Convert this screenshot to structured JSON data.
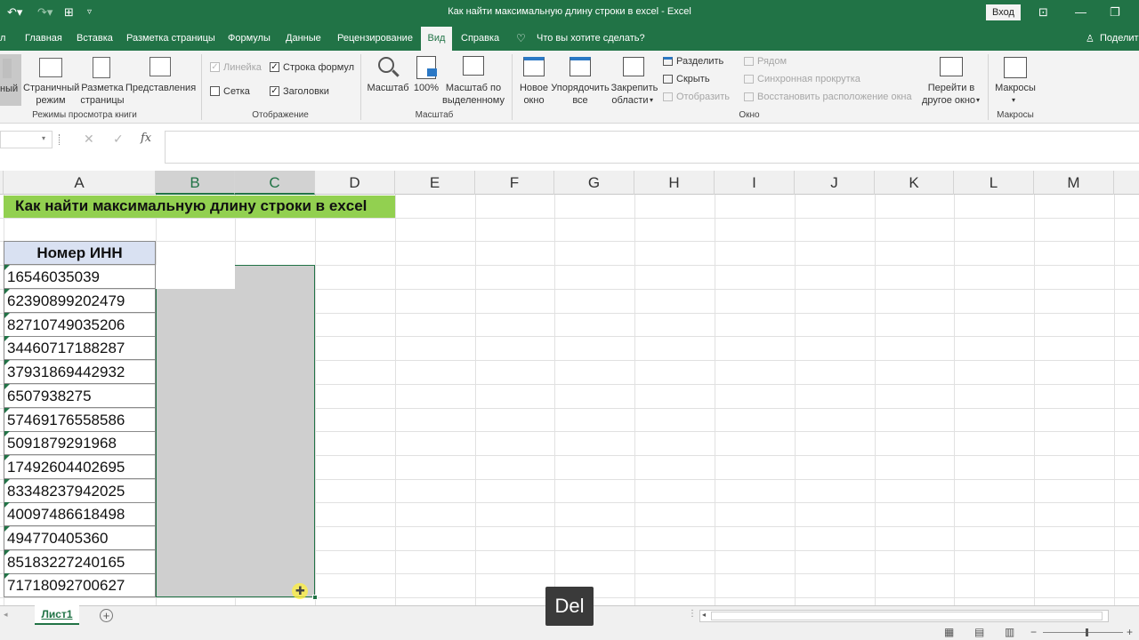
{
  "window": {
    "title": "Как найти максимальную длину строки в excel  -  Excel",
    "signin_label": "Вход",
    "share_label": "Поделит"
  },
  "menu": {
    "items": [
      "Главная",
      "Вставка",
      "Разметка страницы",
      "Формулы",
      "Данные",
      "Рецензирование",
      "Вид",
      "Справка"
    ],
    "active": "Вид",
    "tell_me": "Что вы хотите сделать?"
  },
  "ribbon": {
    "views": {
      "normal_partial": "ный",
      "page_mode_1": "Страничный",
      "page_mode_2": "режим",
      "layout_1": "Разметка",
      "layout_2": "страницы",
      "custom": "Представления",
      "group": "Режимы просмотра книги"
    },
    "show": {
      "ruler": "Линейка",
      "formula_bar": "Строка формул",
      "grid": "Сетка",
      "headers": "Заголовки",
      "group": "Отображение",
      "ruler_checked": true,
      "formula_bar_checked": true,
      "grid_checked": false,
      "headers_checked": true
    },
    "zoom": {
      "zoom": "Масштаб",
      "hundred": "100%",
      "to_sel_1": "Масштаб по",
      "to_sel_2": "выделенному",
      "group": "Масштаб"
    },
    "window": {
      "new_1": "Новое",
      "new_2": "окно",
      "arrange_1": "Упорядочить",
      "arrange_2": "все",
      "freeze_1": "Закрепить",
      "freeze_2": "области",
      "split": "Разделить",
      "hide": "Скрыть",
      "unhide": "Отобразить",
      "side": "Рядом",
      "sync": "Синхронная прокрутка",
      "reset": "Восстановить расположение окна",
      "switch_1": "Перейти в",
      "switch_2": "другое окно",
      "group": "Окно"
    },
    "macros": {
      "label": "Макросы",
      "group": "Макросы"
    }
  },
  "formula_bar": {
    "name_box": "",
    "content": ""
  },
  "columns": [
    "A",
    "B",
    "C",
    "D",
    "E",
    "F",
    "G",
    "H",
    "I",
    "J",
    "K",
    "L",
    "M"
  ],
  "selected_columns": [
    "B",
    "C"
  ],
  "sheet": {
    "banner": "Как найти максимальную длину строки в excel",
    "header": "Номер ИНН",
    "values": [
      "16546035039",
      "62390899202479",
      "82710749035206",
      "34460717188287",
      "37931869442932",
      "6507938275",
      "57469176558586",
      "5091879291968",
      "17492604402695",
      "83348237942025",
      "40097486618498",
      "494770405360",
      "85183227240165",
      "71718092700627"
    ]
  },
  "tabs": {
    "sheet_name": "Лист1"
  },
  "overlay": {
    "key": "Del"
  },
  "colors": {
    "brand": "#217346",
    "banner": "#92d050",
    "header_fill": "#d9e1f2"
  }
}
